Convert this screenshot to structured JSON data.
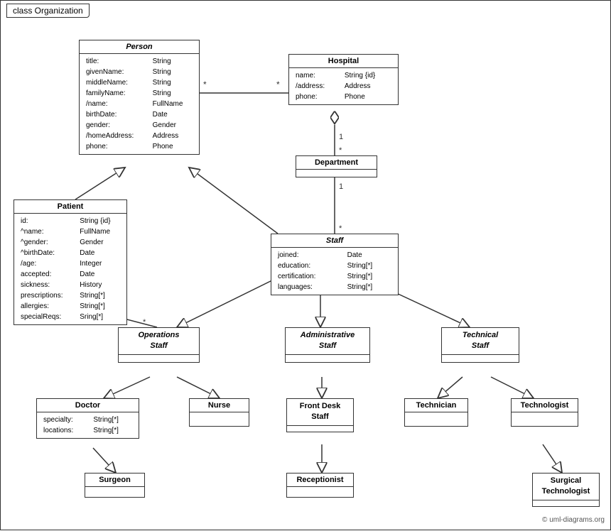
{
  "title": "class Organization",
  "classes": {
    "person": {
      "name": "Person",
      "italic": true,
      "attributes": [
        {
          "name": "title:",
          "type": "String"
        },
        {
          "name": "givenName:",
          "type": "String"
        },
        {
          "name": "middleName:",
          "type": "String"
        },
        {
          "name": "familyName:",
          "type": "String"
        },
        {
          "name": "/name:",
          "type": "FullName"
        },
        {
          "name": "birthDate:",
          "type": "Date"
        },
        {
          "name": "gender:",
          "type": "Gender"
        },
        {
          "name": "/homeAddress:",
          "type": "Address"
        },
        {
          "name": "phone:",
          "type": "Phone"
        }
      ]
    },
    "hospital": {
      "name": "Hospital",
      "italic": false,
      "attributes": [
        {
          "name": "name:",
          "type": "String {id}"
        },
        {
          "name": "/address:",
          "type": "Address"
        },
        {
          "name": "phone:",
          "type": "Phone"
        }
      ]
    },
    "department": {
      "name": "Department",
      "italic": false,
      "attributes": []
    },
    "staff": {
      "name": "Staff",
      "italic": true,
      "attributes": [
        {
          "name": "joined:",
          "type": "Date"
        },
        {
          "name": "education:",
          "type": "String[*]"
        },
        {
          "name": "certification:",
          "type": "String[*]"
        },
        {
          "name": "languages:",
          "type": "String[*]"
        }
      ]
    },
    "patient": {
      "name": "Patient",
      "italic": false,
      "attributes": [
        {
          "name": "id:",
          "type": "String {id}"
        },
        {
          "name": "^name:",
          "type": "FullName"
        },
        {
          "name": "^gender:",
          "type": "Gender"
        },
        {
          "name": "^birthDate:",
          "type": "Date"
        },
        {
          "name": "/age:",
          "type": "Integer"
        },
        {
          "name": "accepted:",
          "type": "Date"
        },
        {
          "name": "sickness:",
          "type": "History"
        },
        {
          "name": "prescriptions:",
          "type": "String[*]"
        },
        {
          "name": "allergies:",
          "type": "String[*]"
        },
        {
          "name": "specialReqs:",
          "type": "Sring[*]"
        }
      ]
    },
    "operations_staff": {
      "name": "Operations\nStaff",
      "italic": true,
      "attributes": []
    },
    "administrative_staff": {
      "name": "Administrative\nStaff",
      "italic": true,
      "attributes": []
    },
    "technical_staff": {
      "name": "Technical\nStaff",
      "italic": true,
      "attributes": []
    },
    "doctor": {
      "name": "Doctor",
      "italic": false,
      "attributes": [
        {
          "name": "specialty:",
          "type": "String[*]"
        },
        {
          "name": "locations:",
          "type": "String[*]"
        }
      ]
    },
    "nurse": {
      "name": "Nurse",
      "italic": false,
      "attributes": []
    },
    "front_desk_staff": {
      "name": "Front Desk\nStaff",
      "italic": false,
      "attributes": []
    },
    "technician": {
      "name": "Technician",
      "italic": false,
      "attributes": []
    },
    "technologist": {
      "name": "Technologist",
      "italic": false,
      "attributes": []
    },
    "surgeon": {
      "name": "Surgeon",
      "italic": false,
      "attributes": []
    },
    "receptionist": {
      "name": "Receptionist",
      "italic": false,
      "attributes": []
    },
    "surgical_technologist": {
      "name": "Surgical\nTechnologist",
      "italic": false,
      "attributes": []
    }
  },
  "copyright": "© uml-diagrams.org"
}
